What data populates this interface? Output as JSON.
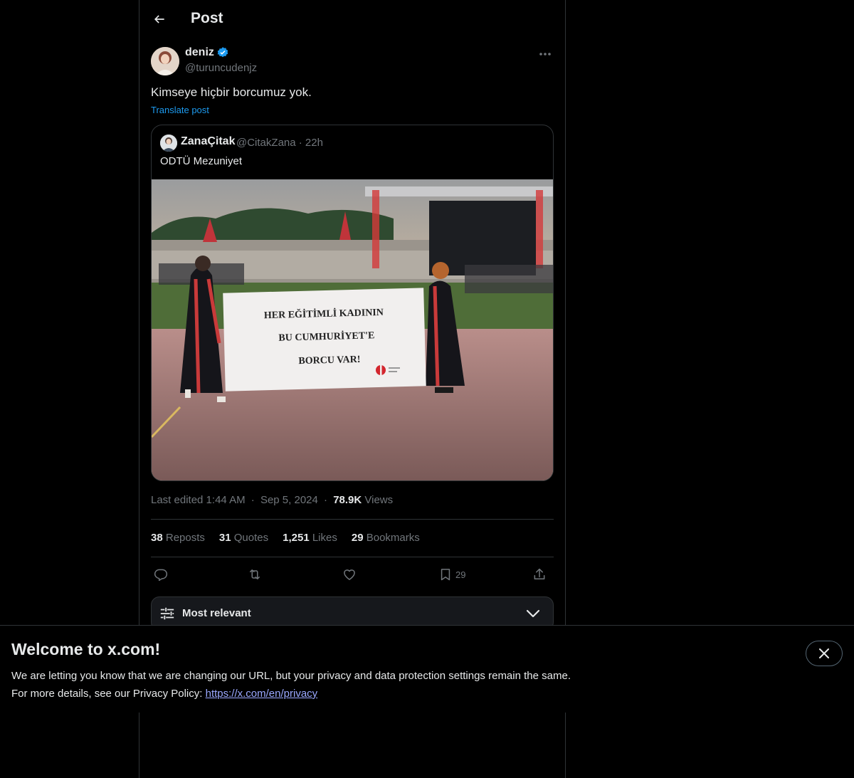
{
  "header": {
    "title": "Post",
    "back_icon": "arrow-left-icon"
  },
  "post": {
    "author_name": "deniz",
    "author_handle": "@turuncudenjz",
    "verified_icon": "verified-badge-icon",
    "text": "Kimseye hiçbir borcumuz yok.",
    "translate_label": "Translate post",
    "edited_label": "Last edited 1:44 AM",
    "sep": "·",
    "date": "Sep 5, 2024",
    "views_count": "78.9K",
    "views_label": "Views"
  },
  "quote": {
    "author_name": "ZanaÇitak",
    "author_handle": "@CitakZana · 22h",
    "text": "ODTÜ Mezuniyet",
    "banner_lines": [
      "HER EĞİTİMLİ KADININ",
      "BU CUMHURİYET'E",
      "BORCU VAR!"
    ]
  },
  "stats": [
    {
      "count": "38",
      "label": "Reposts"
    },
    {
      "count": "31",
      "label": "Quotes"
    },
    {
      "count": "1,251",
      "label": "Likes"
    },
    {
      "count": "29",
      "label": "Bookmarks"
    }
  ],
  "actions": {
    "reply_icon": "reply-icon",
    "repost_icon": "repost-icon",
    "like_icon": "heart-icon",
    "bookmark_icon": "bookmark-icon",
    "bookmark_count": "29",
    "share_icon": "share-icon"
  },
  "replies_sort": {
    "label": "Most relevant",
    "icon": "sliders-icon",
    "chevron": "chevron-down-icon"
  },
  "cookie_banner": {
    "title": "Welcome to x.com!",
    "line1": "We are letting you know that we are changing our URL, but your privacy and data protection settings remain the same.",
    "line2_prefix": "For more details, see our Privacy Policy:",
    "link": "https://x.com/en/privacy",
    "close_icon": "close-icon"
  },
  "colors": {
    "accent": "#1d9bf0",
    "background": "#000000",
    "muted": "#71767b",
    "border": "#2f3336",
    "link": "#9aa8ff"
  }
}
